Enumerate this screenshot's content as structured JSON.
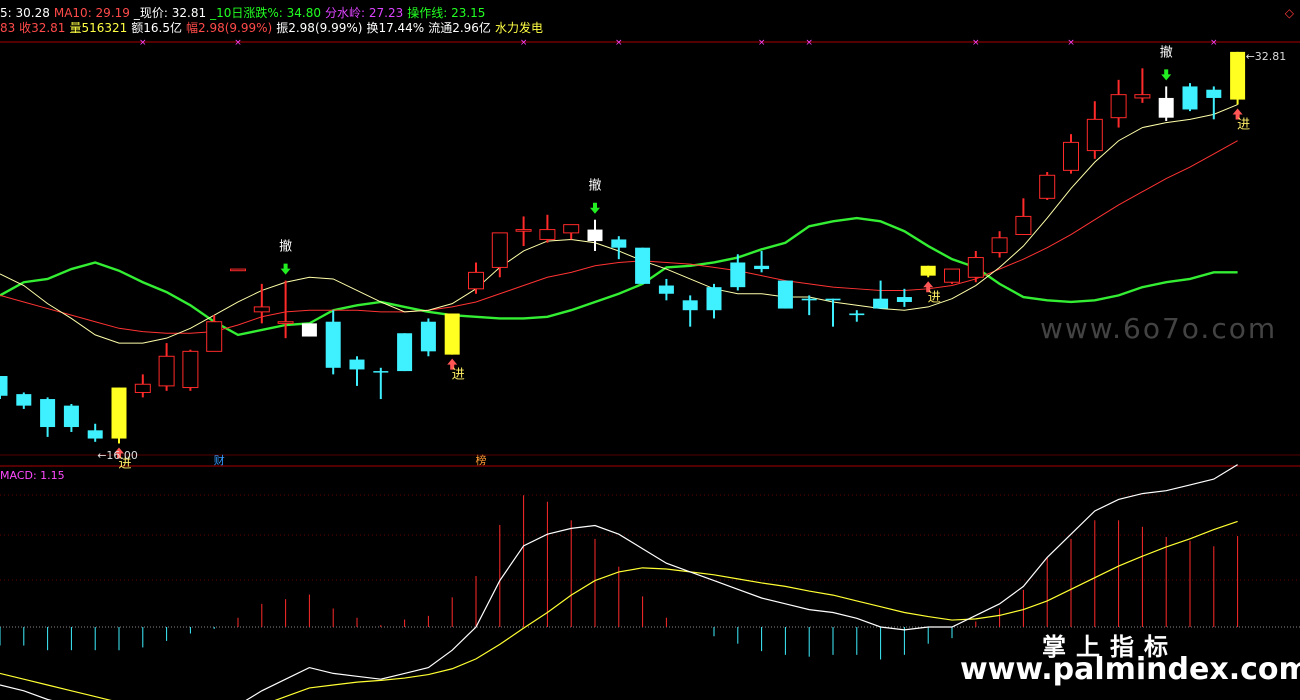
{
  "header": {
    "row1": [
      {
        "text": "5: 30.28",
        "color": "#ffffff"
      },
      {
        "text": "MA10: 29.19",
        "color": "#ff4a4a"
      },
      {
        "text": "_现价: 32.81",
        "color": "#ffffff"
      },
      {
        "text": "_10日涨跌%: 34.80",
        "color": "#22ff22"
      },
      {
        "text": "分水岭: 27.23",
        "color": "#dd44ff"
      },
      {
        "text": "操作线: 23.15",
        "color": "#22ff22"
      }
    ],
    "row2": [
      {
        "text": "83 收32.81",
        "color": "#ff4a4a"
      },
      {
        "text": "量516321",
        "color": "#ffff44"
      },
      {
        "text": "额16.5亿",
        "color": "#ffffff"
      },
      {
        "text": "幅2.98(9.99%)",
        "color": "#ff4a4a"
      },
      {
        "text": "振2.98(9.99%)",
        "color": "#ffffff"
      },
      {
        "text": "换17.44%",
        "color": "#ffffff"
      },
      {
        "text": "流通2.96亿",
        "color": "#ffffff"
      },
      {
        "text": "水力发电",
        "color": "#ffff44"
      }
    ],
    "close_icon": "diamond-icon"
  },
  "macd_label": "MACD: 1.15",
  "watermarks": {
    "top": "www.6o7o.com",
    "brand": "掌上指标",
    "url": "www.palmindex.com"
  },
  "colors": {
    "up": "#ff2a2a",
    "down": "#3ff0ff",
    "signal": "#ffff22",
    "white_candle": "#ffffff",
    "ma5": "#ffffaa",
    "ma10": "#ff3333",
    "opline": "#33ee33",
    "dif": "#ffffff",
    "dea": "#ffff33",
    "grid": "#aa0000"
  },
  "chart_data": {
    "type": "candlestick",
    "price_range": [
      15.5,
      33.8
    ],
    "candles": [
      {
        "o": 20.3,
        "c": 19.1,
        "h": 20.3,
        "l": 18.9,
        "k": "down"
      },
      {
        "o": 19.2,
        "c": 18.5,
        "h": 19.3,
        "l": 18.3,
        "k": "down"
      },
      {
        "o": 18.9,
        "c": 17.2,
        "h": 19.0,
        "l": 16.6,
        "k": "down"
      },
      {
        "o": 18.5,
        "c": 17.2,
        "h": 18.6,
        "l": 16.9,
        "k": "down"
      },
      {
        "o": 17.0,
        "c": 16.5,
        "h": 17.4,
        "l": 16.3,
        "k": "down"
      },
      {
        "o": 16.5,
        "c": 19.6,
        "h": 19.6,
        "l": 16.2,
        "k": "signal"
      },
      {
        "o": 19.3,
        "c": 19.8,
        "h": 20.4,
        "l": 19.0,
        "k": "up"
      },
      {
        "o": 19.7,
        "c": 21.5,
        "h": 22.3,
        "l": 19.4,
        "k": "up"
      },
      {
        "o": 19.6,
        "c": 21.8,
        "h": 21.9,
        "l": 19.4,
        "k": "up"
      },
      {
        "o": 21.8,
        "c": 23.6,
        "h": 24.0,
        "l": 21.8,
        "k": "up"
      },
      {
        "o": 26.7,
        "c": 26.8,
        "h": 26.8,
        "l": 26.7,
        "k": "up"
      },
      {
        "o": 24.2,
        "c": 24.5,
        "h": 25.9,
        "l": 23.5,
        "k": "up"
      },
      {
        "o": 23.5,
        "c": 23.6,
        "h": 26.1,
        "l": 22.6,
        "k": "up"
      },
      {
        "o": 22.7,
        "c": 23.5,
        "h": 23.5,
        "l": 22.7,
        "k": "white"
      },
      {
        "o": 23.6,
        "c": 20.8,
        "h": 24.3,
        "l": 20.4,
        "k": "down"
      },
      {
        "o": 21.3,
        "c": 20.7,
        "h": 21.5,
        "l": 19.7,
        "k": "down"
      },
      {
        "o": 20.6,
        "c": 20.6,
        "h": 20.8,
        "l": 18.9,
        "k": "down"
      },
      {
        "o": 22.9,
        "c": 20.6,
        "h": 22.9,
        "l": 20.6,
        "k": "down"
      },
      {
        "o": 23.6,
        "c": 21.8,
        "h": 23.8,
        "l": 21.5,
        "k": "down"
      },
      {
        "o": 21.6,
        "c": 24.1,
        "h": 24.1,
        "l": 21.6,
        "k": "signal"
      },
      {
        "o": 25.6,
        "c": 26.6,
        "h": 27.2,
        "l": 25.3,
        "k": "up"
      },
      {
        "o": 26.9,
        "c": 29.0,
        "h": 29.0,
        "l": 26.3,
        "k": "up"
      },
      {
        "o": 29.1,
        "c": 29.2,
        "h": 30.0,
        "l": 28.2,
        "k": "up"
      },
      {
        "o": 28.6,
        "c": 29.2,
        "h": 30.1,
        "l": 28.4,
        "k": "up"
      },
      {
        "o": 29.0,
        "c": 29.5,
        "h": 29.5,
        "l": 28.6,
        "k": "up"
      },
      {
        "o": 29.2,
        "c": 28.5,
        "h": 29.8,
        "l": 27.9,
        "k": "white"
      },
      {
        "o": 28.6,
        "c": 28.1,
        "h": 28.8,
        "l": 27.4,
        "k": "down"
      },
      {
        "o": 28.1,
        "c": 25.9,
        "h": 28.1,
        "l": 25.9,
        "k": "down"
      },
      {
        "o": 25.8,
        "c": 25.3,
        "h": 26.2,
        "l": 24.9,
        "k": "down"
      },
      {
        "o": 24.9,
        "c": 24.3,
        "h": 25.2,
        "l": 23.3,
        "k": "down"
      },
      {
        "o": 25.7,
        "c": 24.3,
        "h": 25.9,
        "l": 23.8,
        "k": "down"
      },
      {
        "o": 27.2,
        "c": 25.7,
        "h": 27.7,
        "l": 25.5,
        "k": "down"
      },
      {
        "o": 27.0,
        "c": 26.8,
        "h": 27.9,
        "l": 26.6,
        "k": "down"
      },
      {
        "o": 26.1,
        "c": 24.4,
        "h": 26.1,
        "l": 24.4,
        "k": "down"
      },
      {
        "o": 25.0,
        "c": 24.9,
        "h": 25.2,
        "l": 24.0,
        "k": "down"
      },
      {
        "o": 25.0,
        "c": 24.9,
        "h": 25.0,
        "l": 23.3,
        "k": "down"
      },
      {
        "o": 24.1,
        "c": 24.0,
        "h": 24.3,
        "l": 23.6,
        "k": "down"
      },
      {
        "o": 25.0,
        "c": 24.4,
        "h": 26.1,
        "l": 24.4,
        "k": "down"
      },
      {
        "o": 25.1,
        "c": 24.8,
        "h": 25.6,
        "l": 24.5,
        "k": "down"
      },
      {
        "o": 26.4,
        "c": 27.0,
        "h": 27.0,
        "l": 26.3,
        "k": "signal"
      },
      {
        "o": 26.0,
        "c": 26.8,
        "h": 26.8,
        "l": 25.9,
        "k": "up"
      },
      {
        "o": 26.3,
        "c": 27.5,
        "h": 27.9,
        "l": 26.0,
        "k": "up"
      },
      {
        "o": 27.8,
        "c": 28.7,
        "h": 29.1,
        "l": 27.5,
        "k": "up"
      },
      {
        "o": 28.9,
        "c": 30.0,
        "h": 31.1,
        "l": 28.9,
        "k": "up"
      },
      {
        "o": 31.1,
        "c": 32.5,
        "h": 32.7,
        "l": 31.0,
        "k": "up"
      },
      {
        "o": 32.8,
        "c": 34.5,
        "h": 35.0,
        "l": 32.6,
        "k": "up"
      },
      {
        "o": 34.0,
        "c": 35.9,
        "h": 37.0,
        "l": 33.5,
        "k": "up"
      },
      {
        "o": 36.0,
        "c": 37.4,
        "h": 38.3,
        "l": 35.4,
        "k": "up"
      },
      {
        "o": 37.2,
        "c": 37.4,
        "h": 39.0,
        "l": 36.9,
        "k": "up"
      },
      {
        "o": 37.2,
        "c": 36.0,
        "h": 37.9,
        "l": 35.8,
        "k": "white"
      },
      {
        "o": 37.9,
        "c": 36.5,
        "h": 38.1,
        "l": 36.4,
        "k": "down"
      },
      {
        "o": 37.7,
        "c": 37.2,
        "h": 37.9,
        "l": 35.9,
        "k": "down"
      },
      {
        "o": 37.1,
        "c": 40.0,
        "h": 40.0,
        "l": 36.8,
        "k": "signal"
      }
    ],
    "ma5": [
      26.5,
      25.8,
      24.7,
      23.8,
      22.8,
      22.3,
      22.3,
      22.6,
      23.2,
      24.0,
      24.8,
      25.5,
      26.0,
      26.3,
      26.2,
      25.5,
      24.8,
      24.2,
      24.3,
      24.7,
      25.6,
      26.9,
      27.9,
      28.5,
      28.6,
      28.4,
      27.9,
      27.3,
      26.8,
      26.2,
      25.6,
      25.3,
      25.3,
      25.1,
      25.1,
      24.8,
      24.6,
      24.4,
      24.3,
      24.5,
      25.0,
      25.8,
      26.9,
      28.2,
      29.9,
      31.7,
      33.3,
      34.6,
      35.4,
      35.7,
      35.9,
      36.2,
      36.8
    ],
    "ma10": [
      25.2,
      24.8,
      24.4,
      24.0,
      23.6,
      23.2,
      23.0,
      22.9,
      22.9,
      23.0,
      23.4,
      23.9,
      24.2,
      24.3,
      24.3,
      24.3,
      24.2,
      24.2,
      24.3,
      24.5,
      24.8,
      25.3,
      25.8,
      26.3,
      26.6,
      27.0,
      27.2,
      27.3,
      27.2,
      27.1,
      26.9,
      26.7,
      26.4,
      26.1,
      25.9,
      25.7,
      25.6,
      25.5,
      25.5,
      25.6,
      25.8,
      26.2,
      26.8,
      27.4,
      28.1,
      28.9,
      29.8,
      30.7,
      31.5,
      32.3,
      33.0,
      33.8,
      34.6
    ],
    "opline": [
      25.2,
      26.0,
      26.2,
      26.8,
      27.2,
      26.7,
      26.0,
      25.4,
      24.6,
      23.6,
      22.8,
      23.1,
      23.4,
      23.5,
      24.3,
      24.6,
      24.8,
      24.5,
      24.2,
      24.0,
      23.9,
      23.8,
      23.8,
      23.9,
      24.3,
      24.8,
      25.3,
      25.9,
      26.9,
      27.0,
      27.2,
      27.5,
      28.0,
      28.4,
      29.4,
      29.7,
      29.9,
      29.7,
      29.1,
      28.2,
      27.4,
      26.9,
      25.9,
      25.1,
      24.9,
      24.8,
      24.9,
      25.2,
      25.7,
      26.0,
      26.2,
      26.6,
      26.6
    ],
    "signals": [
      {
        "i": 5,
        "type": "buy",
        "label": "进"
      },
      {
        "i": 12,
        "type": "sell",
        "label": "撤"
      },
      {
        "i": 19,
        "type": "buy",
        "label": "进"
      },
      {
        "i": 25,
        "type": "sell",
        "label": "撤"
      },
      {
        "i": 39,
        "type": "buy",
        "label": "进"
      },
      {
        "i": 49,
        "type": "sell",
        "label": "撤"
      },
      {
        "i": 52,
        "type": "buy",
        "label": "进"
      }
    ],
    "price_labels": [
      {
        "i": 4,
        "text": "16.00",
        "pos": "low"
      },
      {
        "i": 52,
        "text": "32.81",
        "pos": "high"
      }
    ],
    "news_markers": [
      {
        "i": 9,
        "text": "财",
        "color": "#3399ff"
      },
      {
        "i": 20,
        "text": "榜",
        "color": "#ff9933"
      }
    ],
    "x_marks": [
      6,
      10,
      22,
      26,
      32,
      34,
      41,
      45,
      51
    ],
    "macd": {
      "range": [
        -2.2,
        2.7
      ],
      "dif": [
        -1.0,
        -1.1,
        -1.25,
        -1.35,
        -1.45,
        -1.55,
        -1.6,
        -1.6,
        -1.55,
        -1.5,
        -1.35,
        -1.1,
        -0.9,
        -0.7,
        -0.8,
        -0.85,
        -0.9,
        -0.8,
        -0.7,
        -0.4,
        0.0,
        0.8,
        1.4,
        1.6,
        1.7,
        1.75,
        1.6,
        1.35,
        1.1,
        0.95,
        0.8,
        0.65,
        0.5,
        0.4,
        0.3,
        0.25,
        0.15,
        0.0,
        -0.05,
        0.0,
        0.0,
        0.2,
        0.4,
        0.7,
        1.2,
        1.6,
        2.0,
        2.2,
        2.3,
        2.35,
        2.45,
        2.55,
        2.8
      ],
      "dea": [
        -0.8,
        -0.9,
        -1.0,
        -1.1,
        -1.2,
        -1.3,
        -1.38,
        -1.45,
        -1.48,
        -1.48,
        -1.45,
        -1.35,
        -1.2,
        -1.05,
        -1.0,
        -0.95,
        -0.92,
        -0.88,
        -0.82,
        -0.72,
        -0.55,
        -0.3,
        -0.02,
        0.25,
        0.55,
        0.8,
        0.95,
        1.02,
        1.0,
        0.95,
        0.9,
        0.83,
        0.76,
        0.7,
        0.62,
        0.55,
        0.45,
        0.35,
        0.25,
        0.18,
        0.12,
        0.14,
        0.2,
        0.3,
        0.45,
        0.65,
        0.85,
        1.05,
        1.22,
        1.38,
        1.52,
        1.68,
        1.82
      ],
      "bar_width": 1
    }
  }
}
